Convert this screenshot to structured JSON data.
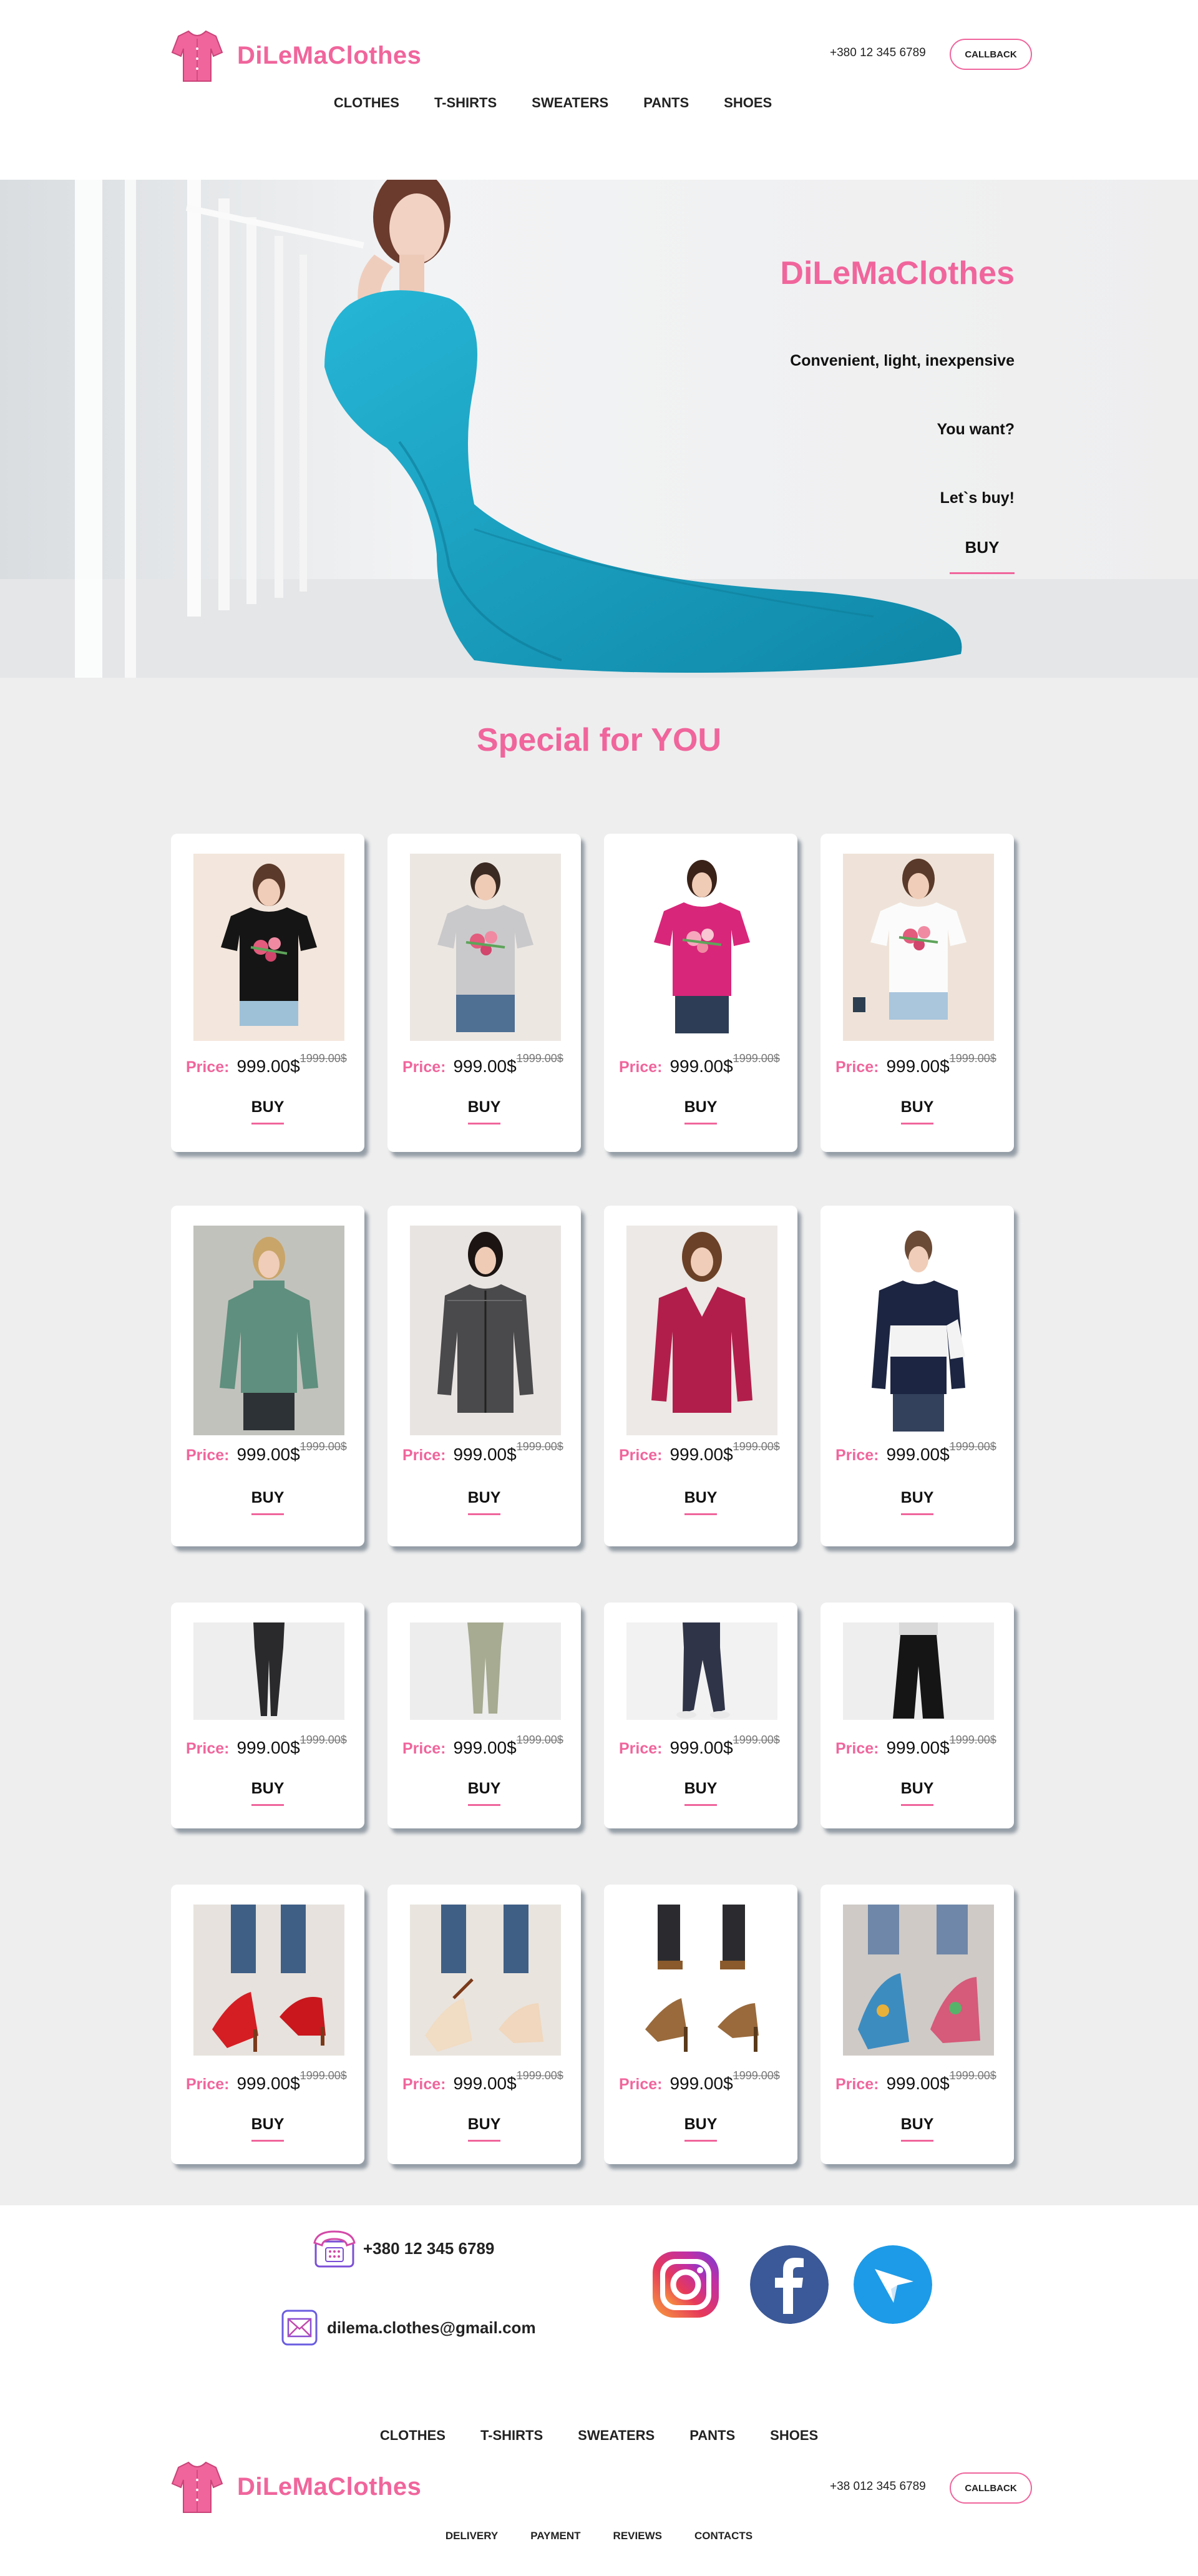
{
  "header": {
    "brand": "DiLeMaClothes",
    "phone": "+380 12 345 6789",
    "callback": "CALLBACK",
    "nav": [
      "CLOTHES",
      "T-SHIRTS",
      "SWEATERS",
      "PANTS",
      "SHOES"
    ]
  },
  "hero": {
    "title": "DiLeMaClothes",
    "line1": "Convenient, light, inexpensive",
    "line2": "You want?",
    "line3": "Let`s buy!",
    "buy": "BUY"
  },
  "special": {
    "title": "Special for YOU",
    "price_label": "Price:",
    "price_now": "999.00$",
    "price_old": "1999.00$",
    "buy": "BUY"
  },
  "products": [
    {
      "name": "black flower t-shirt",
      "category": "t-shirts"
    },
    {
      "name": "grey flower t-shirt",
      "category": "t-shirts"
    },
    {
      "name": "pink flower t-shirt",
      "category": "t-shirts"
    },
    {
      "name": "white flower t-shirt",
      "category": "t-shirts"
    },
    {
      "name": "green turtleneck sweater",
      "category": "sweaters"
    },
    {
      "name": "grey cardigan",
      "category": "sweaters"
    },
    {
      "name": "red v-neck sweater",
      "category": "sweaters"
    },
    {
      "name": "navy white sweater",
      "category": "sweaters"
    },
    {
      "name": "black pants",
      "category": "pants"
    },
    {
      "name": "olive pants",
      "category": "pants"
    },
    {
      "name": "navy joggers",
      "category": "pants"
    },
    {
      "name": "black wide pants",
      "category": "pants"
    },
    {
      "name": "red heels",
      "category": "shoes"
    },
    {
      "name": "beige heels",
      "category": "shoes"
    },
    {
      "name": "leopard heels",
      "category": "shoes"
    },
    {
      "name": "floral heels",
      "category": "shoes"
    }
  ],
  "contacts": {
    "phone": "+380 12 345 6789",
    "email": "dilema.clothes@gmail.com",
    "social": [
      "instagram-icon",
      "facebook-icon",
      "telegram-icon"
    ]
  },
  "footer": {
    "nav": [
      "CLOTHES",
      "T-SHIRTS",
      "SWEATERS",
      "PANTS",
      "SHOES"
    ],
    "brand": "DiLeMaClothes",
    "phone": "+38 012 345 6789",
    "callback": "CALLBACK",
    "links": [
      "DELIVERY",
      "PAYMENT",
      "REVIEWS",
      "CONTACTS"
    ]
  },
  "colors": {
    "accent": "#f0659c",
    "section_bg": "#eeeeee",
    "hero_dress": "#1aa3c2",
    "facebook": "#3b5998",
    "telegram": "#1d9be8"
  }
}
